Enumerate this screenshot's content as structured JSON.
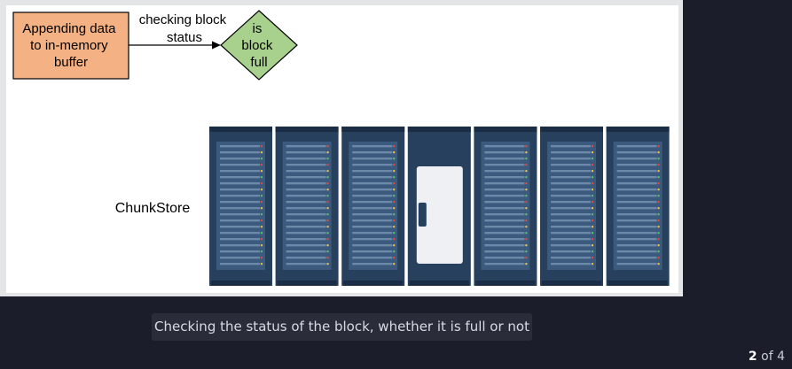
{
  "diagram": {
    "process_box": {
      "lines": [
        "Appending data",
        "to in-memory",
        "buffer"
      ],
      "fill": "#f4b183"
    },
    "arrow_label": {
      "lines": [
        "checking block",
        "status"
      ]
    },
    "decision": {
      "lines": [
        "is",
        "block",
        "full"
      ],
      "fill": "#a9d18e"
    },
    "store_label": "ChunkStore",
    "rack_colors": {
      "body": "#26405e",
      "top": "#1a2d44",
      "panel": "#3b5a7d",
      "door": "#eef0f3"
    },
    "rack_count": 7,
    "door_index": 3
  },
  "caption": "Checking the status of the block, whether it is full or not",
  "pager": {
    "current": "2",
    "separator": "of",
    "total": "4"
  }
}
